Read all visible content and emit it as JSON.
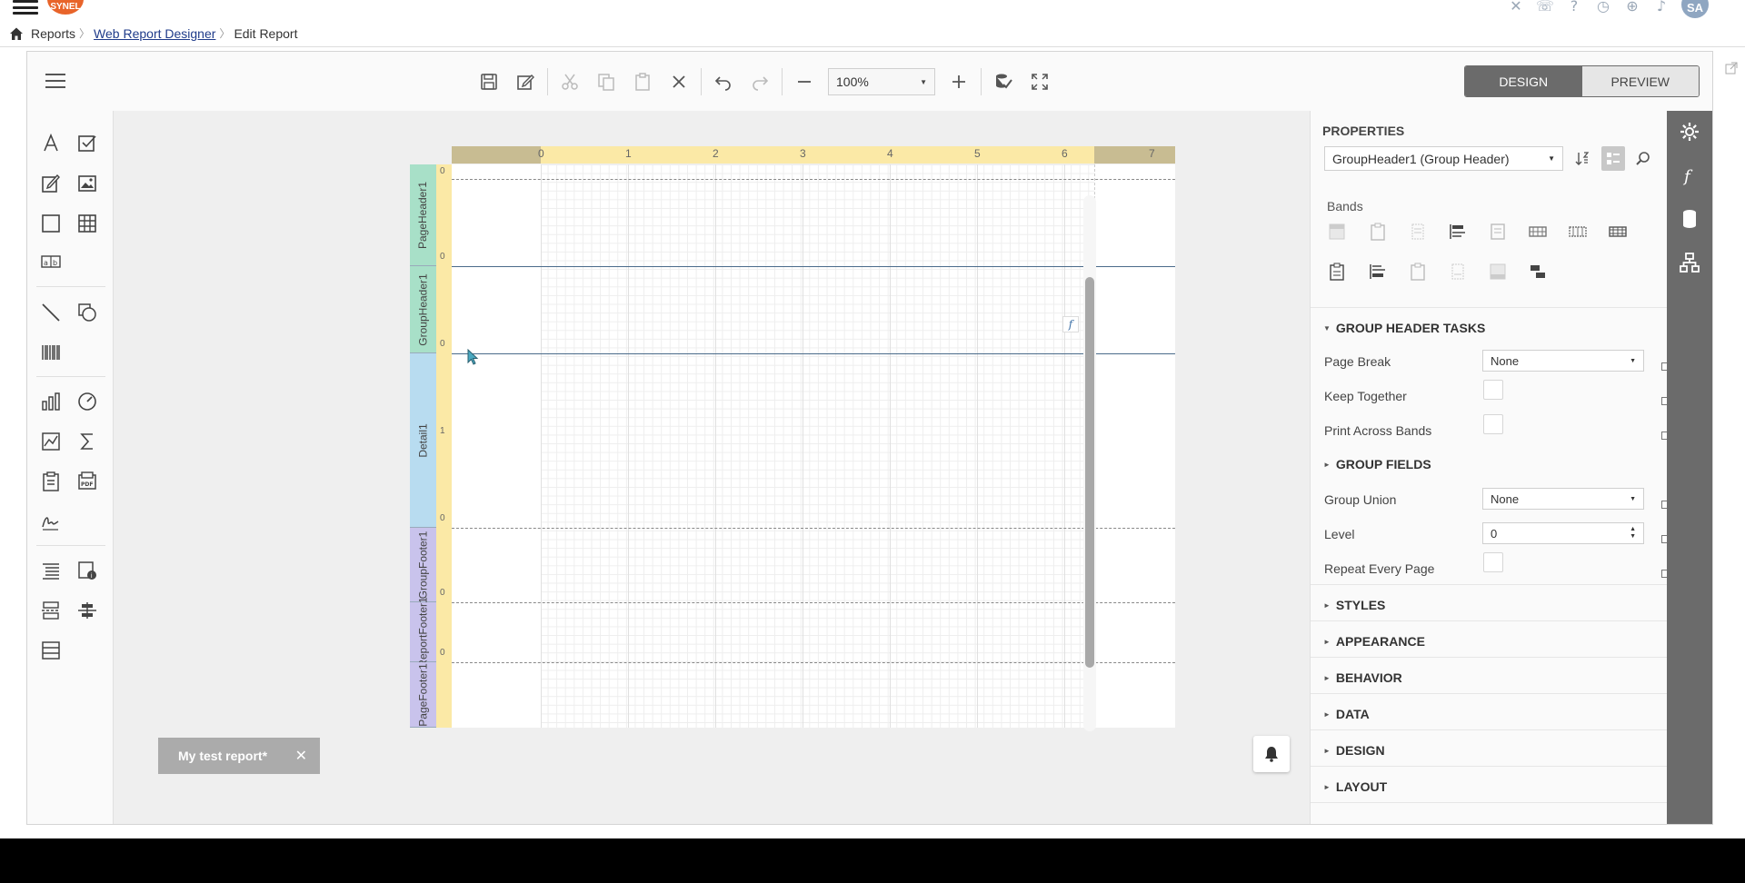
{
  "topbar": {
    "logo_text": "SYNEL",
    "avatar_initials": "SA",
    "icons": [
      "share-icon",
      "phone-icon",
      "help-icon",
      "clock-icon",
      "globe-icon",
      "bell-icon"
    ]
  },
  "breadcrumb": {
    "items": [
      "Reports",
      "Web Report Designer",
      "Edit Report"
    ]
  },
  "toolbar": {
    "zoom_value": "100%",
    "design_label": "DESIGN",
    "preview_label": "PREVIEW"
  },
  "surface": {
    "ruler_top_numbers": [
      "0",
      "1",
      "2",
      "3",
      "4",
      "5",
      "6",
      "7"
    ],
    "ruler_left_numbers": [
      "0",
      "0",
      "0",
      "1",
      "0",
      "0",
      "0"
    ],
    "bands": [
      "PageHeader1",
      "GroupHeader1",
      "Detail1",
      "GroupFooter1",
      "ReportFooter1",
      "PageFooter1"
    ],
    "fx_label": "f",
    "tab_title": "My test report*",
    "tab_close": "✕"
  },
  "properties": {
    "title": "PROPERTIES",
    "selected_object": "GroupHeader1 (Group Header)",
    "bands_label": "Bands",
    "group_header_tasks": "GROUP HEADER TASKS",
    "page_break_label": "Page Break",
    "page_break_value": "None",
    "keep_together_label": "Keep Together",
    "print_across_label": "Print Across Bands",
    "group_fields": "GROUP FIELDS",
    "group_union_label": "Group Union",
    "group_union_value": "None",
    "level_label": "Level",
    "level_value": "0",
    "repeat_label": "Repeat Every Page",
    "sections": [
      "STYLES",
      "APPEARANCE",
      "BEHAVIOR",
      "DATA",
      "DESIGN",
      "LAYOUT"
    ]
  }
}
